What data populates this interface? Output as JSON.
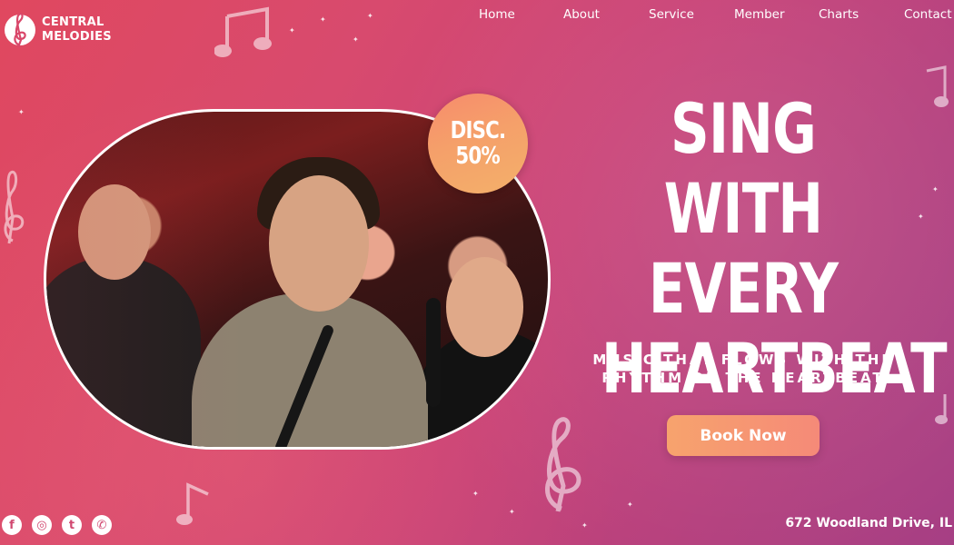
{
  "brand": {
    "line1": "CENTRAL",
    "line2": "MELODIES"
  },
  "nav": {
    "items": [
      "Home",
      "About",
      "Service",
      "Member",
      "Charts",
      "Contact"
    ]
  },
  "badge": {
    "line1": "DISC.",
    "line2": "50%"
  },
  "hero": {
    "headline": [
      "SING WITH",
      "EVERY",
      "HEARTBEAT"
    ],
    "subtitle_line1": "MUSIC THAT FLOWS WITH THE",
    "subtitle_line2": "RHYTHM OF THE HEARTBEAT",
    "cta_label": "Book Now"
  },
  "social": {
    "icons": [
      "facebook-icon",
      "instagram-icon",
      "twitter-icon",
      "whatsapp-icon"
    ],
    "glyphs": [
      "f",
      "◎",
      "t",
      "✆"
    ]
  },
  "footer": {
    "address": "672 Woodland Drive, IL"
  },
  "colors": {
    "background_start": "#e0485f",
    "background_end": "#a63f84",
    "cta_start": "#f7a36d",
    "cta_end": "#f58a78",
    "badge": "#f5a06a"
  }
}
